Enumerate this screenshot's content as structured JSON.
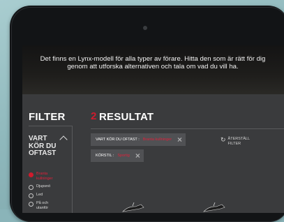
{
  "hero": {
    "text": "Det finns en Lynx-modell för alla typer av förare. Hitta den som är rätt för dig genom att utforska alternativen och tala om vad du vill ha."
  },
  "filter": {
    "title": "FILTER",
    "group": {
      "title": "VART KÖR DU OFTAST",
      "options": [
        {
          "label": "Branta kullninger",
          "selected": true
        },
        {
          "label": "Djupsnö",
          "selected": false
        },
        {
          "label": "Led",
          "selected": false
        },
        {
          "label": "På och utanför",
          "selected": false
        }
      ]
    }
  },
  "results": {
    "number": "2",
    "title": "RESULTAT",
    "chips": [
      {
        "label": "VART KÖR DU OFTAST :",
        "value": "Branta kullninger"
      },
      {
        "label": "KÖRSTIL :",
        "value": "Sportig"
      }
    ],
    "reset_label": "ÅTERSTÄLL FILTER"
  },
  "colors": {
    "accent": "#d01b2d",
    "panel": "#3a3b3d",
    "chip": "#505154"
  }
}
